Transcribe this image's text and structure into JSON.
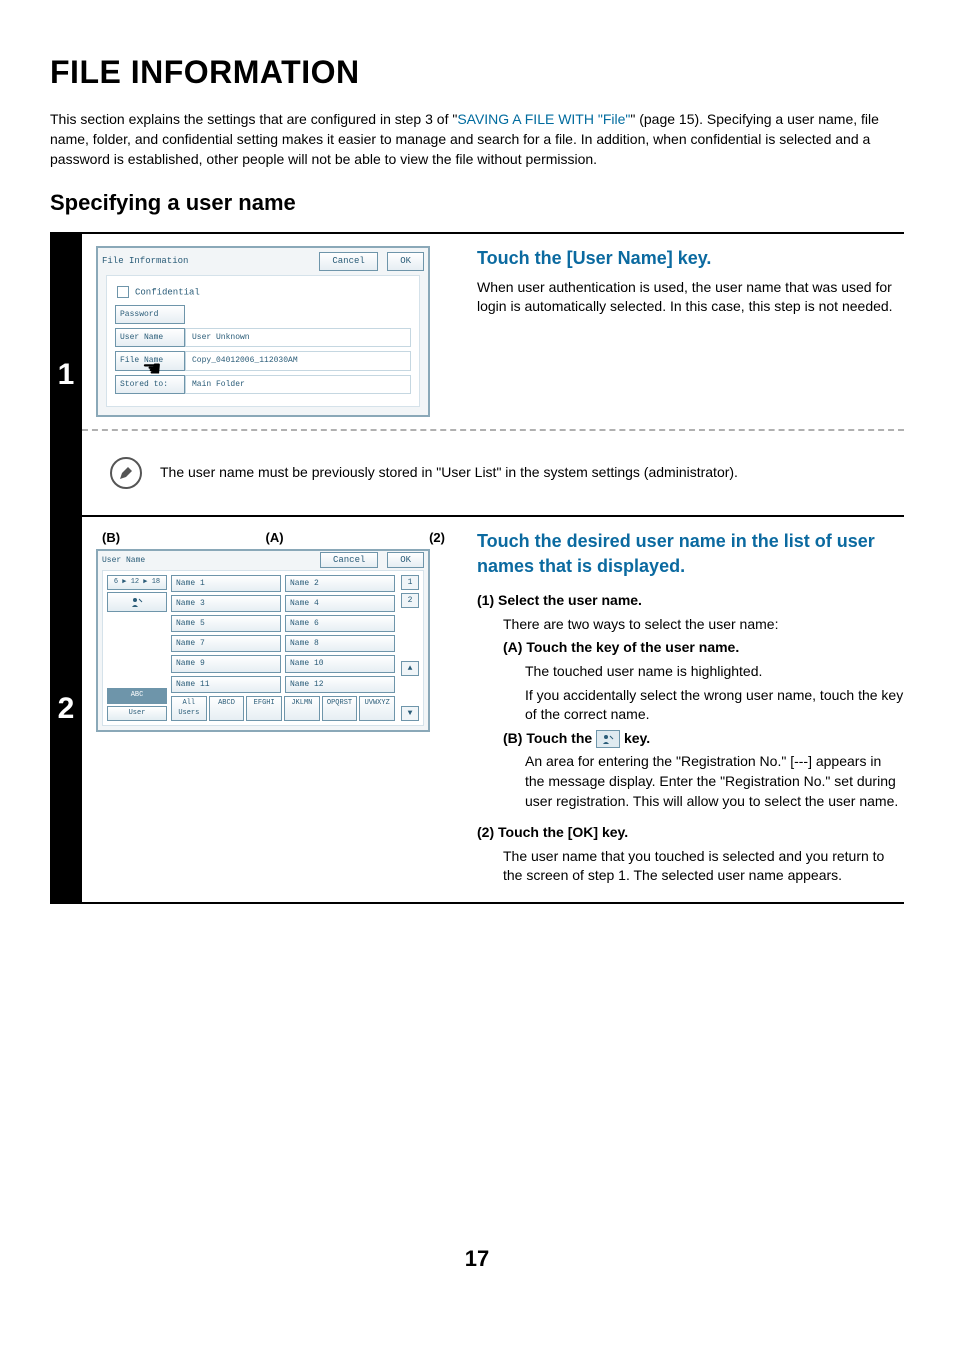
{
  "title": "FILE INFORMATION",
  "intro_pre": "This section explains the settings that are configured in step 3 of \"",
  "intro_link": "SAVING A FILE WITH \"File\"",
  "intro_post": "\" (page 15). Specifying a user name, file name, folder, and confidential setting makes it easier to manage and search for a file. In addition, when confidential is selected and a password is established, other people will not be able to view the file without permission.",
  "subtitle": "Specifying a user name",
  "step1": {
    "num": "1",
    "heading": "Touch the [User Name] key.",
    "text": "When user authentication is used, the user name that was used for login is automatically selected. In this case, this step is not needed.",
    "note": "The user name must be previously stored in \"User List\" in the system settings (administrator).",
    "panel": {
      "title": "File Information",
      "cancel": "Cancel",
      "ok": "OK",
      "confidential": "Confidential",
      "password": "Password",
      "user_name_key": "User Name",
      "user_name_val": "User Unknown",
      "file_name_key": "File Name",
      "file_name_val": "Copy_04012006_112030AM",
      "stored_key": "Stored to:",
      "stored_val": "Main Folder"
    }
  },
  "step2": {
    "num": "2",
    "markers": {
      "b": "(B)",
      "a": "(A)",
      "two": "(2)"
    },
    "heading": "Touch the desired user name in the list of user names that is displayed.",
    "s1_title": "(1)  Select the user name.",
    "s1_lead": "There are two ways to select the user name:",
    "s1_a_head": "(A) Touch the key of the user name.",
    "s1_a_l1": "The touched user name is highlighted.",
    "s1_a_l2": "If you accidentally select the wrong user name, touch the key of the correct name.",
    "s1_b_head_pre": "(B) Touch the ",
    "s1_b_head_post": " key.",
    "s1_b_body": "An area for entering the \"Registration No.\" [---] appears in the message display. Enter the \"Registration No.\" set during user registration. This will allow you to select the user name.",
    "s2_title": "(2)  Touch the [OK] key.",
    "s2_body": "The user name that you touched is selected and you return to the screen of step 1. The selected user name appears.",
    "panel": {
      "title": "User Name",
      "cancel": "Cancel",
      "ok": "OK",
      "side_top": "6 ▶ 12 ▶ 18",
      "side_abc": "ABC",
      "side_user": "User",
      "names": [
        "Name 1",
        "Name 2",
        "Name 3",
        "Name 4",
        "Name 5",
        "Name 6",
        "Name 7",
        "Name 8",
        "Name 9",
        "Name 10",
        "Name 11",
        "Name 12"
      ],
      "pages": [
        "1",
        "2"
      ],
      "alpha": [
        "All Users",
        "ABCD",
        "EFGHI",
        "JKLMN",
        "OPQRST",
        "UVWXYZ"
      ]
    }
  },
  "page": "17"
}
